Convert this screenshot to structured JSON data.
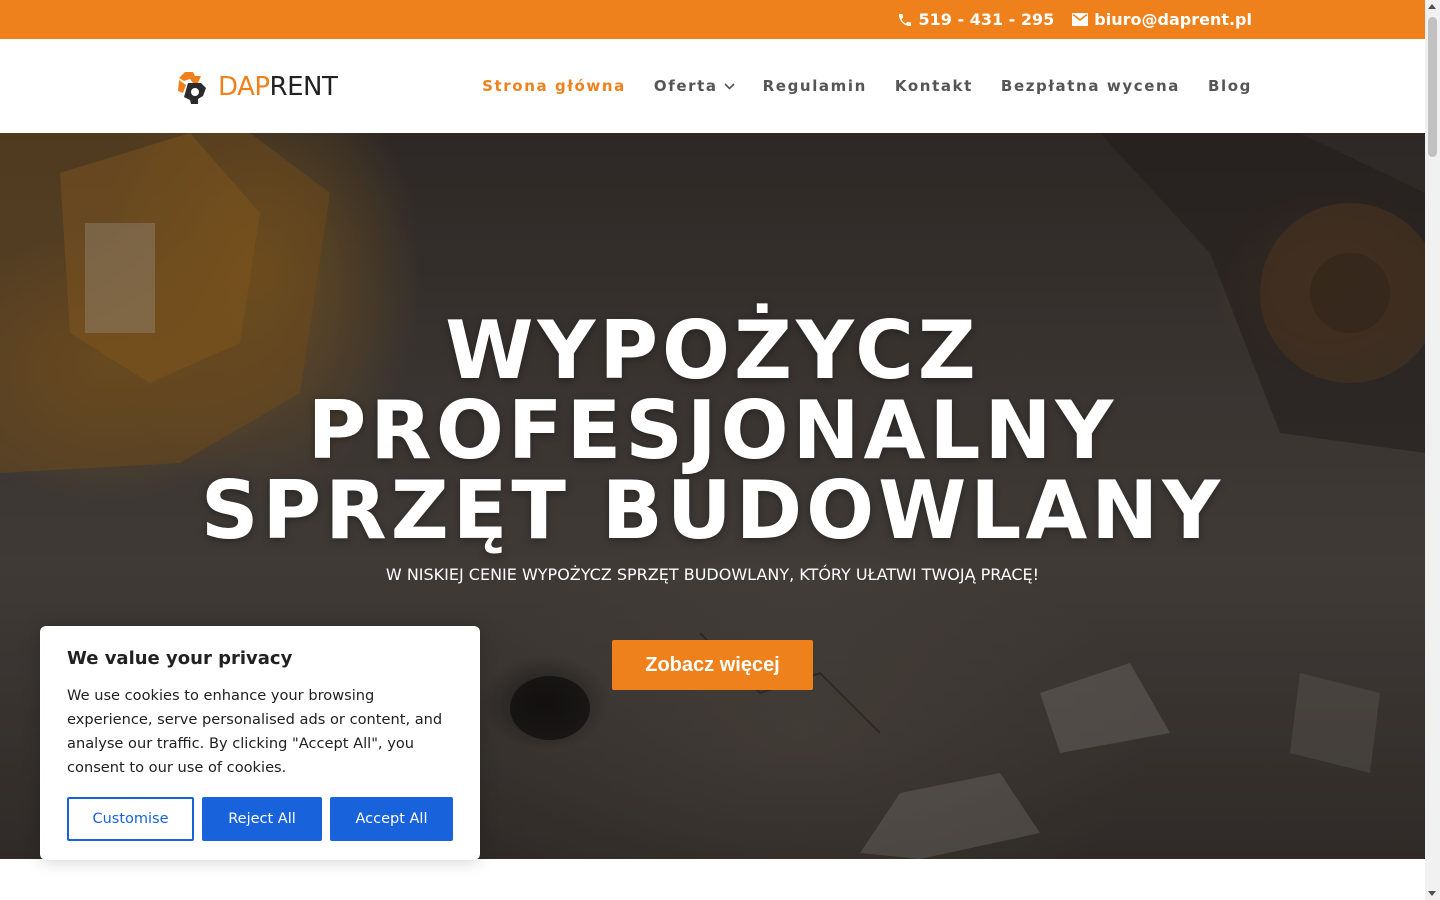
{
  "topbar": {
    "phone": "519 - 431 - 295",
    "email": "biuro@daprent.pl",
    "phone_icon": "phone-icon",
    "email_icon": "envelope-icon"
  },
  "logo": {
    "part1": "DAP",
    "part2": "RENT",
    "icon": "gear-logo-icon"
  },
  "nav": {
    "items": [
      {
        "label": "Strona główna",
        "active": true
      },
      {
        "label": "Oferta",
        "has_dropdown": true
      },
      {
        "label": "Regulamin"
      },
      {
        "label": "Kontakt"
      },
      {
        "label": "Bezpłatna wycena"
      },
      {
        "label": "Blog"
      }
    ]
  },
  "hero": {
    "title_line1": "WYPOŻYCZ",
    "title_line2": "PROFESJONALNY",
    "title_line3": "SPRZĘT BUDOWLANY",
    "subtitle": "W NISKIEJ CENIE WYPOŻYCZ SPRZĘT BUDOWLANY, KTÓRY UŁATWI TWOJĄ PRACĘ!",
    "button": "Zobacz więcej"
  },
  "cookie": {
    "title": "We value your privacy",
    "text": "We use cookies to enhance your browsing experience, serve personalised ads or content, and analyse our traffic. By clicking \"Accept All\", you consent to our use of cookies.",
    "customise": "Customise",
    "reject": "Reject All",
    "accept": "Accept All"
  },
  "colors": {
    "brand_orange": "#ef811c",
    "cookie_blue": "#1863dc",
    "nav_text": "#555555"
  }
}
